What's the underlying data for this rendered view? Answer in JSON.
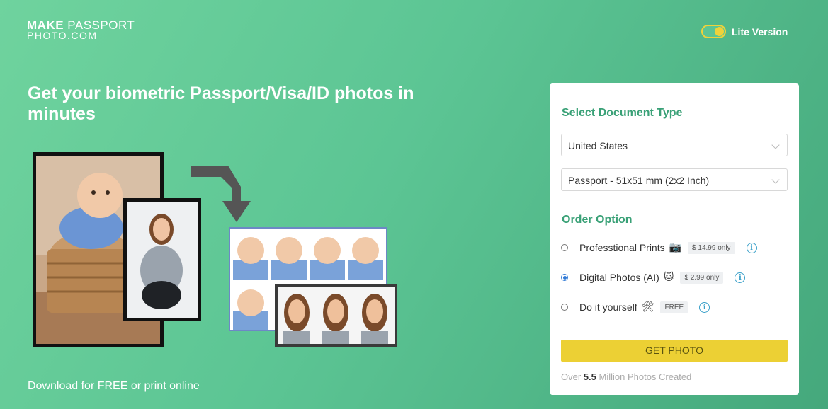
{
  "logo": {
    "line1_bold": "MAKE",
    "line1_light": "PASSPORT",
    "line2": "PHOTO.COM"
  },
  "lite_toggle": {
    "label": "Lite Version"
  },
  "hero": {
    "headline": "Get your biometric Passport/Visa/ID photos in minutes",
    "footer": "Download for FREE or print online"
  },
  "form": {
    "document_heading": "Select Document Type",
    "country_select": "United States",
    "document_select": "Passport - 51x51 mm (2x2 Inch)",
    "order_heading": "Order Option",
    "options": [
      {
        "label": "Professtional Prints",
        "emoji": "📷",
        "price": "$ 14.99 only",
        "selected": false
      },
      {
        "label": "Digital Photos (AI)",
        "emoji": "🐱",
        "price": "$ 2.99 only",
        "selected": true
      },
      {
        "label": "Do it yourself",
        "emoji": "🛠",
        "price": "FREE",
        "selected": false
      }
    ],
    "info_icon": "i",
    "button": "GET PHOTO",
    "stats_prefix": "Over",
    "stats_value": "5.5",
    "stats_suffix": "Million Photos Created"
  },
  "colors": {
    "accent_green": "#3aa177",
    "button_yellow": "#ecd034",
    "radio_blue": "#2f79d6"
  }
}
